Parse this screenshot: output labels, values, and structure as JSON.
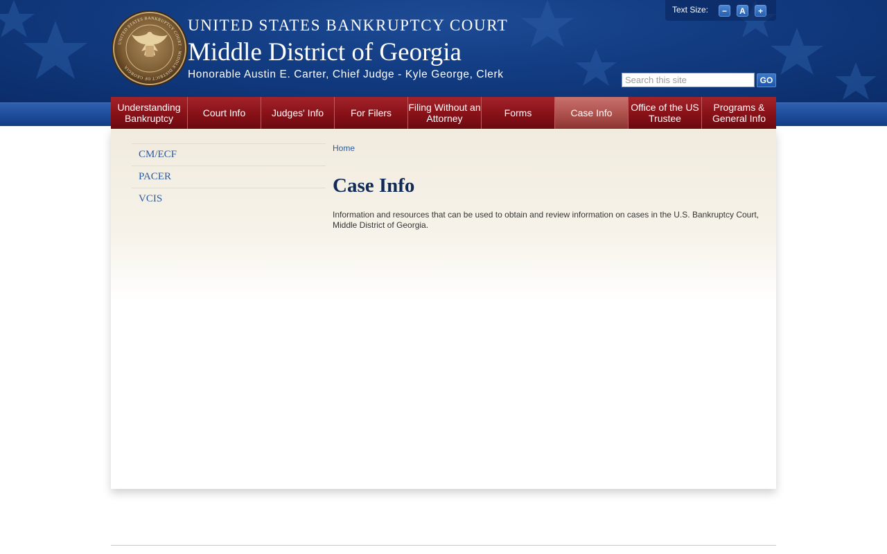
{
  "header": {
    "court_name": "UNITED STATES BANKRUPTCY COURT",
    "district": "Middle District of Georgia",
    "officials": "Honorable Austin E. Carter, Chief Judge - Kyle George, Clerk",
    "seal_icon": "court-seal-icon",
    "seal_text": "UNITED STATES BANKRUPTCY COURT · MIDDLE DISTRICT OF GEORGIA"
  },
  "text_size": {
    "label": "Text Size:",
    "decrease": "−",
    "reset": "A",
    "increase": "+"
  },
  "search": {
    "placeholder": "Search this site",
    "value": "",
    "button": "GO"
  },
  "nav": {
    "items": [
      {
        "label": "Understanding Bankruptcy",
        "active": false
      },
      {
        "label": "Court Info",
        "active": false
      },
      {
        "label": "Judges' Info",
        "active": false
      },
      {
        "label": "For Filers",
        "active": false
      },
      {
        "label": "Filing Without an Attorney",
        "active": false
      },
      {
        "label": "Forms",
        "active": false
      },
      {
        "label": "Case Info",
        "active": true
      },
      {
        "label": "Office of the US Trustee",
        "active": false
      },
      {
        "label": "Programs & General Info",
        "active": false
      }
    ]
  },
  "sidebar": {
    "items": [
      {
        "label": "CM/ECF"
      },
      {
        "label": "PACER"
      },
      {
        "label": "VCIS"
      }
    ]
  },
  "main": {
    "breadcrumb": "Home",
    "title": "Case Info",
    "description": "Information and resources that can be used to obtain and review information on cases in the U.S. Bankruptcy Court, Middle District of Georgia."
  },
  "colors": {
    "header_blue": "#123c82",
    "nav_red": "#8a1219",
    "nav_active": "#b0534f",
    "link_blue": "#2b5a9e",
    "title_navy": "#0f2b56"
  }
}
